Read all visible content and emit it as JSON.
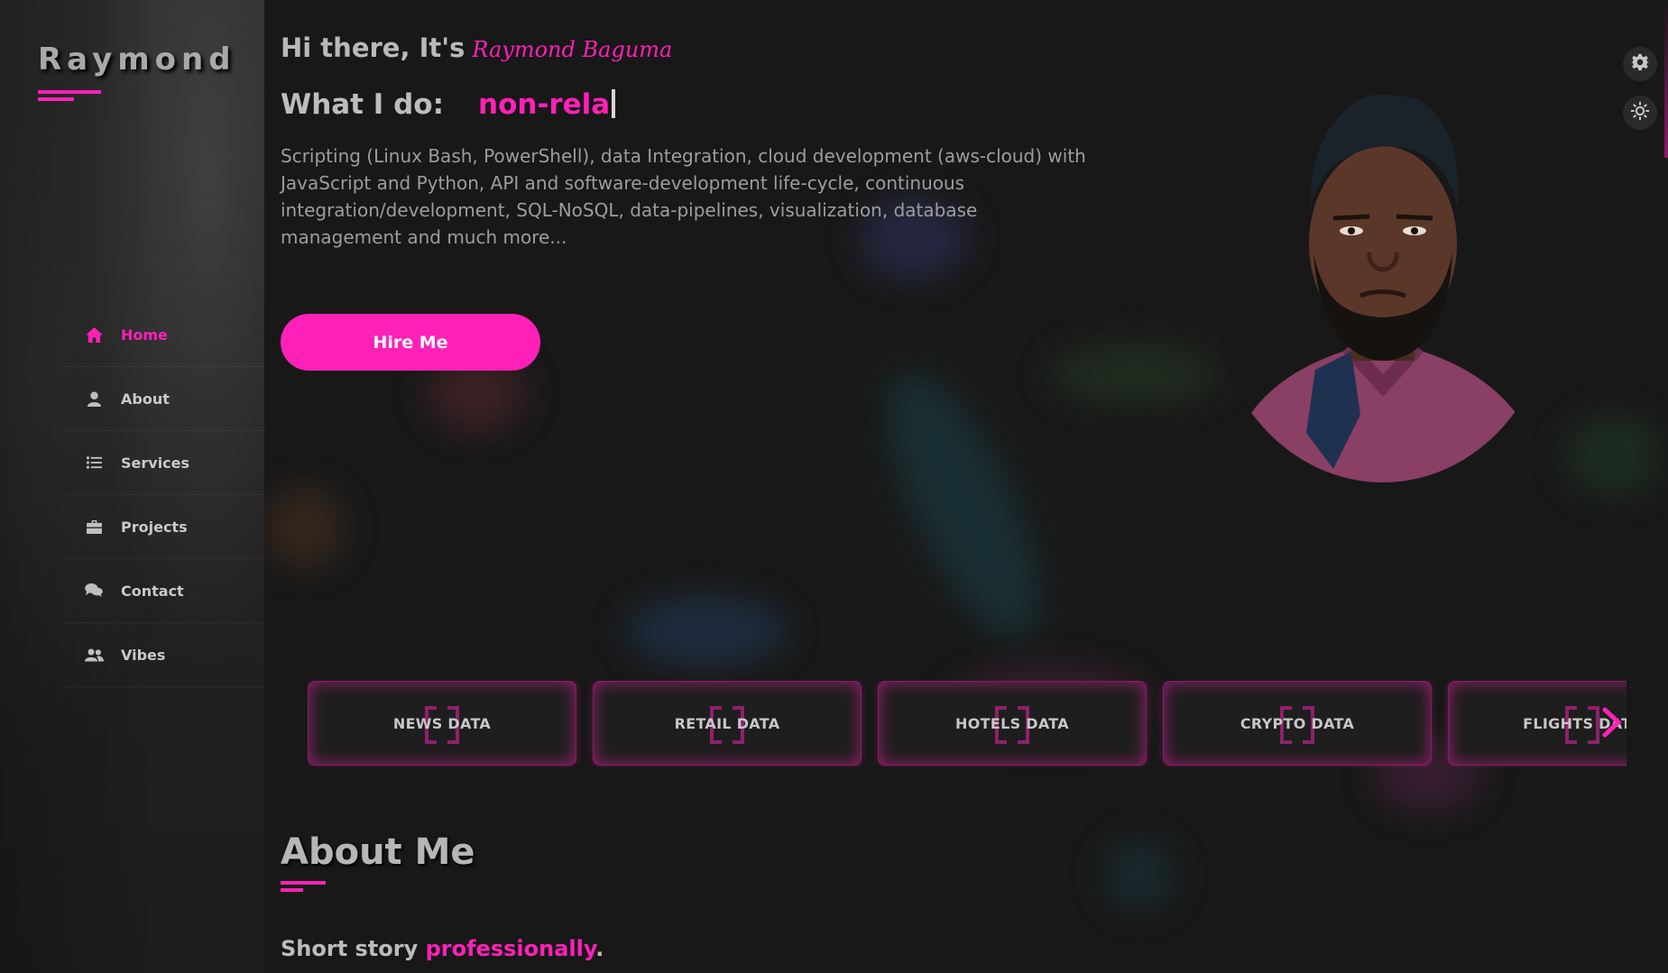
{
  "sidebar": {
    "logo": "Raymond",
    "items": [
      {
        "label": "Home",
        "icon": "home-icon",
        "active": true
      },
      {
        "label": "About",
        "icon": "user-icon",
        "active": false
      },
      {
        "label": "Services",
        "icon": "list-icon",
        "active": false
      },
      {
        "label": "Projects",
        "icon": "briefcase-icon",
        "active": false
      },
      {
        "label": "Contact",
        "icon": "chat-icon",
        "active": false
      },
      {
        "label": "Vibes",
        "icon": "users-icon",
        "active": false
      }
    ]
  },
  "hero": {
    "greeting_prefix": "Hi there, It's",
    "name_script": "Raymond Baguma",
    "what_label": "What I do:",
    "typed_text": "non-rela",
    "intro": "Scripting (Linux Bash, PowerShell), data Integration, cloud development (aws-cloud) with JavaScript and Python, API and software-development life-cycle, continuous integration/development, SQL-NoSQL, data-pipelines, visualization, database management and much more...",
    "hire_button": "Hire Me"
  },
  "settings": {
    "icons": [
      "gear-icon",
      "sun-gear-icon"
    ]
  },
  "cards": [
    {
      "label": "NEWS DATA"
    },
    {
      "label": "RETAIL DATA"
    },
    {
      "label": "HOTELS DATA"
    },
    {
      "label": "CRYPTO DATA"
    },
    {
      "label": "FLIGHTS DATA"
    }
  ],
  "about": {
    "title": "About Me",
    "story_prefix": "Short story",
    "story_accent": "professionally",
    "story_suffix": "."
  },
  "colors": {
    "accent": "#ff21b7",
    "background": "#181818",
    "sidebar": "#262626"
  }
}
